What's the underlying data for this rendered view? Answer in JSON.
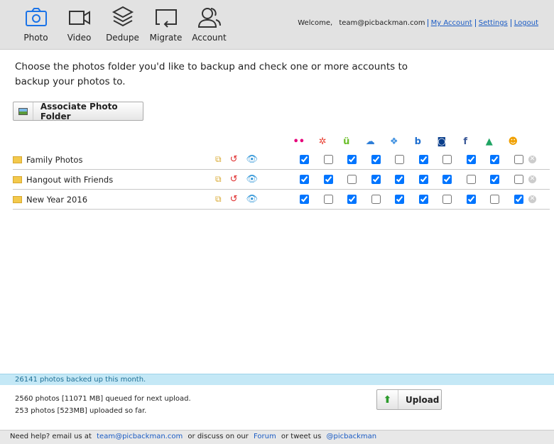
{
  "nav": [
    {
      "label": "Photo",
      "icon": "camera-icon",
      "active": true
    },
    {
      "label": "Video",
      "icon": "video-icon"
    },
    {
      "label": "Dedupe",
      "icon": "layers-icon"
    },
    {
      "label": "Migrate",
      "icon": "migrate-icon"
    },
    {
      "label": "Account",
      "icon": "users-icon"
    }
  ],
  "user": {
    "welcome": "Welcome,",
    "email": "team@picbackman.com",
    "my_account": "My Account",
    "settings": "Settings",
    "logout": "Logout"
  },
  "intro": "Choose the photos folder you'd like to backup and check one or more accounts to backup your photos to.",
  "associate_label": "Associate Photo Folder",
  "services": [
    {
      "name": "flickr",
      "glyph": "••",
      "color": "#e6007a"
    },
    {
      "name": "google-photos",
      "glyph": "✲",
      "color": "#e94235"
    },
    {
      "name": "smugmug",
      "glyph": "ü",
      "color": "#6cbf2b"
    },
    {
      "name": "onedrive",
      "glyph": "☁",
      "color": "#2d7ed8"
    },
    {
      "name": "dropbox",
      "glyph": "❖",
      "color": "#3d8fe0"
    },
    {
      "name": "box",
      "glyph": "b",
      "color": "#2070d0"
    },
    {
      "name": "camera-service",
      "glyph": "◙",
      "color": "#0a3f8c"
    },
    {
      "name": "facebook",
      "glyph": "f",
      "color": "#3b5998"
    },
    {
      "name": "google-drive",
      "glyph": "▲",
      "color": "#1fa463"
    },
    {
      "name": "other-service",
      "glyph": "☻",
      "color": "#f0a000"
    }
  ],
  "folders": [
    {
      "name": "Family  Photos",
      "checks": [
        true,
        false,
        true,
        true,
        false,
        true,
        false,
        true,
        true,
        false
      ]
    },
    {
      "name": "Hangout with Friends",
      "checks": [
        true,
        true,
        false,
        true,
        true,
        true,
        true,
        false,
        true,
        false
      ]
    },
    {
      "name": "New Year 2016",
      "checks": [
        true,
        false,
        true,
        false,
        true,
        true,
        false,
        true,
        false,
        true
      ]
    }
  ],
  "status": "26141 photos backed up this month.",
  "queued": "2560 photos [11071 MB] queued for next upload.",
  "uploaded": "253 photos [523MB] uploaded so far.",
  "upload_label": "Upload",
  "footer": {
    "help": "Need help? email us at",
    "email": "team@picbackman.com",
    "discuss": "or discuss on our",
    "forum": "Forum",
    "tweet": "or tweet us",
    "twitter": "@picbackman"
  }
}
